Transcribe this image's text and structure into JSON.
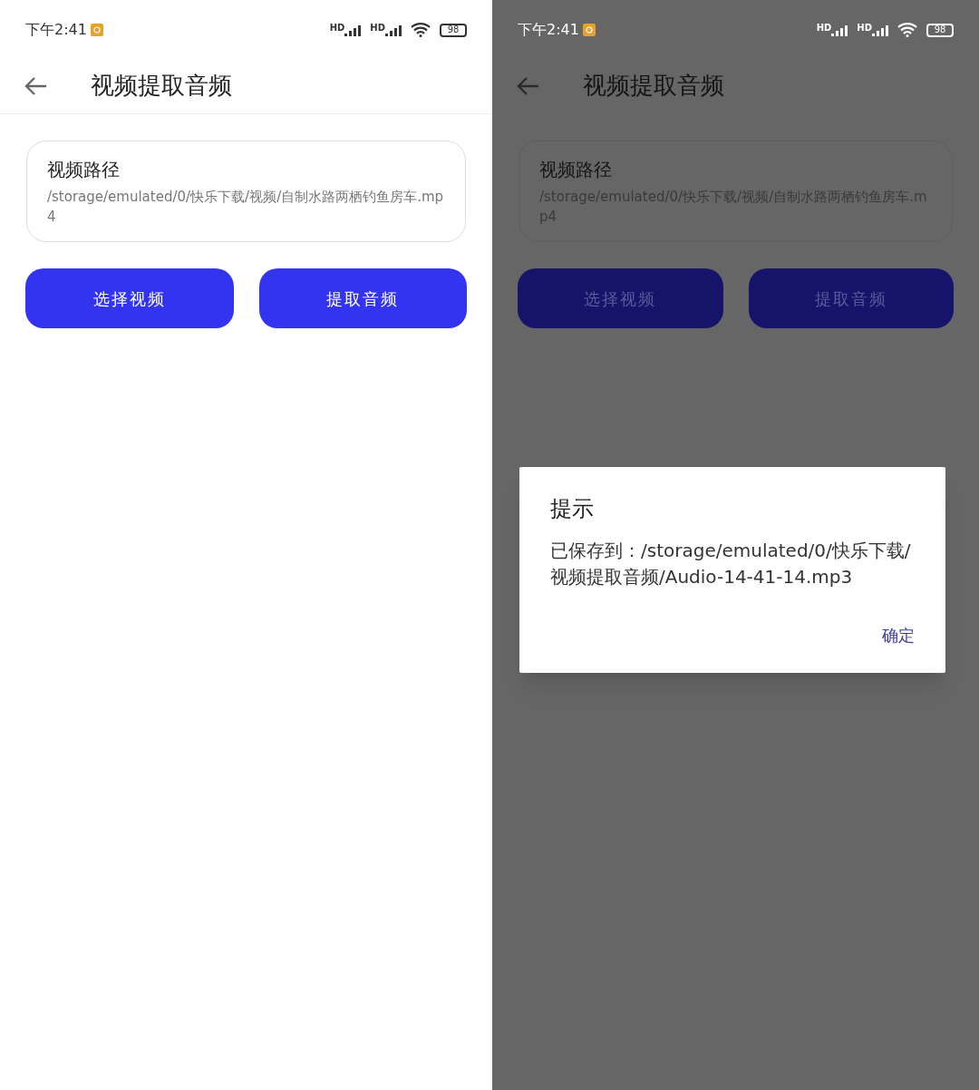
{
  "screens": [
    {
      "dimmed": false,
      "status_bar": {
        "time": "下午2:41",
        "network_labels": [
          "HD",
          "HD"
        ],
        "battery": "98"
      },
      "title": "视频提取音频",
      "field": {
        "label": "视频路径",
        "value": "/storage/emulated/0/快乐下载/视频/自制水路两栖钓鱼房车.mp4"
      },
      "buttons": [
        "选择视频",
        "提取音频"
      ]
    },
    {
      "dimmed": true,
      "status_bar": {
        "time": "下午2:41",
        "network_labels": [
          "HD",
          "HD"
        ],
        "battery": "98"
      },
      "title": "视频提取音频",
      "field": {
        "label": "视频路径",
        "value": "/storage/emulated/0/快乐下载/视频/自制水路两栖钓鱼房车.mp4"
      },
      "buttons": [
        "选择视频",
        "提取音频"
      ],
      "dialog": {
        "title": "提示",
        "message": "已保存到：/storage/emulated/0/快乐下载/视频提取音频/Audio-14-41-14.mp3",
        "button": "确定"
      }
    }
  ]
}
